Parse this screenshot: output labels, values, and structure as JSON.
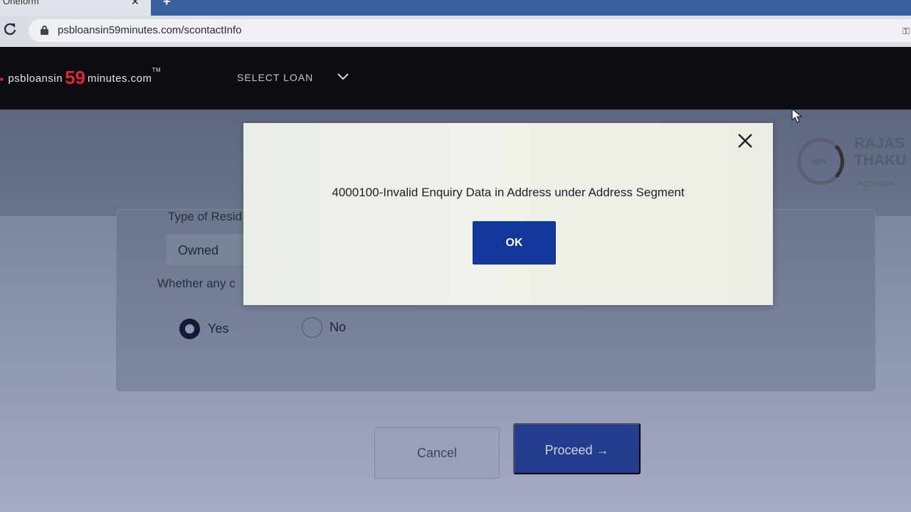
{
  "browser": {
    "tab_title": "Oneform",
    "tab_close": "✕",
    "new_tab": "+",
    "url": "psbloansin59minutes.com/scontactInfo"
  },
  "header": {
    "logo": {
      "prefix": "psbloansin",
      "number": "59",
      "suffix": "minutes.com",
      "tm": "TM"
    },
    "select_loan": "SELECT LOAN"
  },
  "profile": {
    "progress": "50%",
    "name_line1": "RAJAS",
    "name_line2": "THAKU",
    "role": "Applicant"
  },
  "form": {
    "residence_label": "Type of Resid",
    "residence_value": "Owned",
    "question_label": "Whether any c",
    "options": [
      {
        "label": "Yes",
        "selected": true
      },
      {
        "label": "No",
        "selected": false
      }
    ]
  },
  "actions": {
    "cancel": "Cancel",
    "proceed": "Proceed →"
  },
  "modal": {
    "message": "4000100-Invalid Enquiry Data in Address under Address Segment",
    "ok": "OK"
  },
  "colors": {
    "header_bg": "#0c0d12",
    "brand_red": "#e2262b",
    "primary_blue": "#13379a"
  }
}
